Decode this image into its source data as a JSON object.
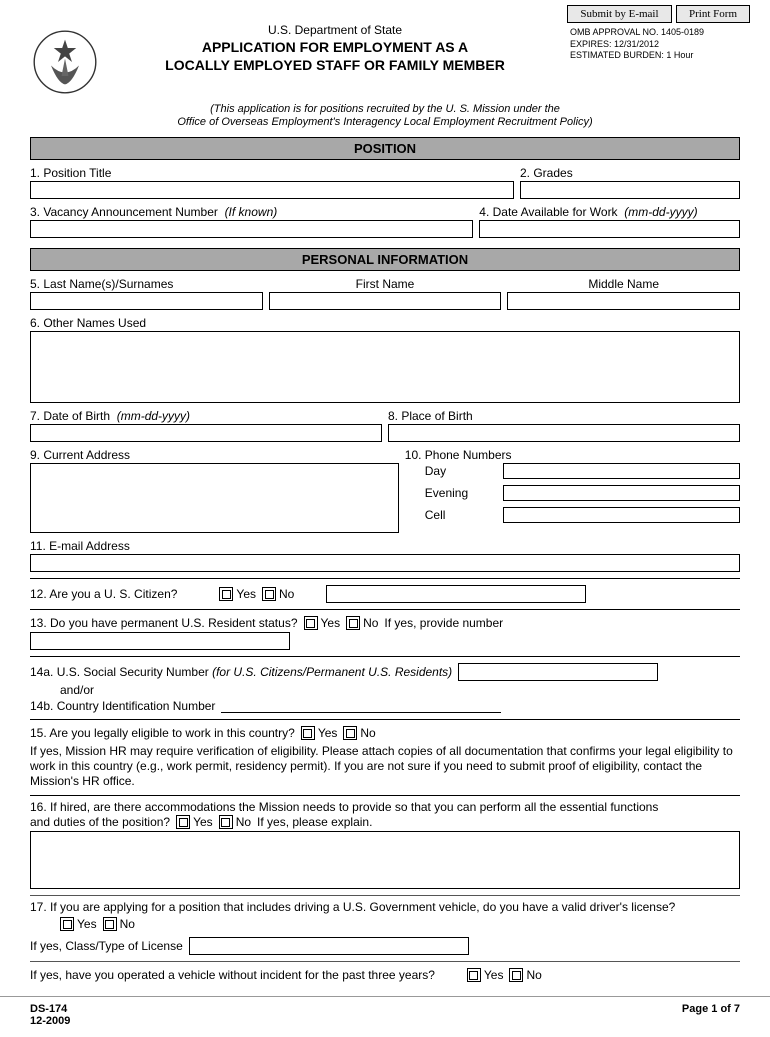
{
  "top": {
    "submit": "Submit by E-mail",
    "print": "Print Form"
  },
  "header": {
    "dept": "U.S. Department of State",
    "title1": "APPLICATION FOR EMPLOYMENT AS A",
    "title2": "LOCALLY EMPLOYED STAFF OR FAMILY MEMBER",
    "omb1": "OMB APPROVAL NO. 1405-0189",
    "omb2": "EXPIRES: 12/31/2012",
    "omb3": "ESTIMATED BURDEN: 1 Hour",
    "sub1": "(This application is for positions recruited by the U. S. Mission under the",
    "sub2": "Office of Overseas Employment's Interagency Local Employment Recruitment Policy)"
  },
  "sections": {
    "position": "POSITION",
    "personal": "PERSONAL INFORMATION"
  },
  "labels": {
    "q1": "1. Position Title",
    "q2": "2. Grades",
    "q3": "3. Vacancy Announcement Number",
    "q3_hint": "(If known)",
    "q4": "4. Date Available for Work",
    "q4_hint": "(mm-dd-yyyy)",
    "q5": "5.  Last Name(s)/Surnames",
    "q5_first": "First Name",
    "q5_middle": "Middle Name",
    "q6": "6. Other Names Used",
    "q7": "7. Date of Birth",
    "q7_hint": "(mm-dd-yyyy)",
    "q8": "8. Place of Birth",
    "q9": "9. Current Address",
    "q10": "10. Phone Numbers",
    "day": "Day",
    "evening": "Evening",
    "cell": "Cell",
    "q11": "11. E-mail Address",
    "q12": "12. Are you a U. S. Citizen?",
    "q13": "13. Do you have permanent U.S. Resident status?",
    "q13b": "If yes, provide number",
    "q14a": "14a. U.S. Social Security Number",
    "q14a_hint": "(for U.S. Citizens/Permanent U.S. Residents)",
    "andor": "and/or",
    "q14b": "14b. Country Identification Number",
    "q15": "15.  Are you legally eligible to work in this country?",
    "q15_note": "If yes, Mission HR may require verification of eligibility.  Please attach copies of all documentation that confirms your legal eligibility to work in this country (e.g.,  work permit, residency permit).  If you are not sure if you need to submit proof of eligibility, contact the Mission's HR office.",
    "q16a": "16. If hired, are there accommodations the Mission needs to provide so that you can perform all the essential functions",
    "q16b": "and duties of the position?",
    "q16c": "If yes, please explain.",
    "q17": "17. If you are applying for a position that includes driving a U.S. Government vehicle, do you have a valid driver's license?",
    "q17b": "If yes, Class/Type of  License",
    "q17c": "If yes, have you operated a vehicle without incident for the past three years?",
    "yes": "Yes",
    "no": "No"
  },
  "footer": {
    "form": "DS-174",
    "rev": "12-2009",
    "page": "Page 1 of 7"
  }
}
